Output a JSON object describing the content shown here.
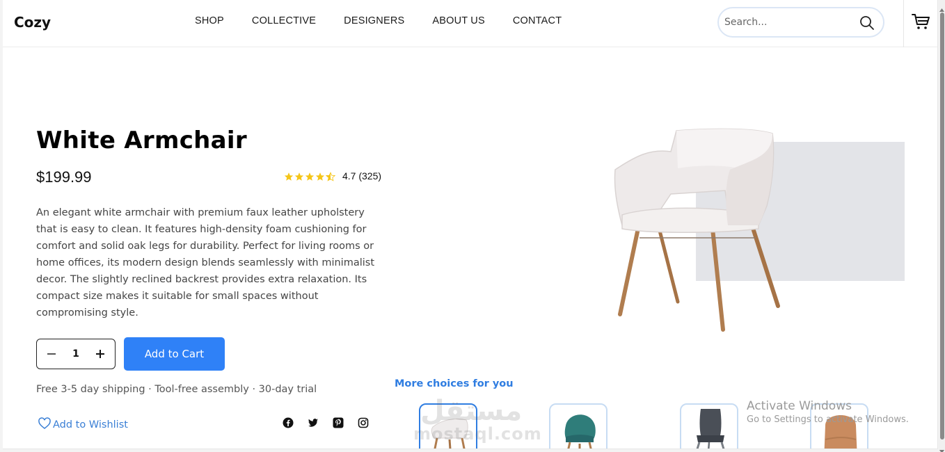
{
  "header": {
    "logo": "Cozy",
    "nav": [
      "SHOP",
      "COLLECTIVE",
      "DESIGNERS",
      "ABOUT US",
      "CONTACT"
    ],
    "search_placeholder": "Search..."
  },
  "product": {
    "title": "White Armchair",
    "price": "$199.99",
    "rating_stars": 4.5,
    "rating_text": "4.7 (325)",
    "description": "An elegant white armchair with premium faux leather upholstery that is easy to clean. It features high-density foam cushioning for comfort and solid oak legs for durability. Perfect for living rooms or home offices, its modern design blends seamlessly with minimalist decor. The slightly reclined backrest provides extra relaxation. Its compact size makes it suitable for small spaces without compromising style.",
    "quantity": "1",
    "add_to_cart": "Add to Cart",
    "perks": "Free 3-5 day shipping · Tool-free assembly · 30-day trial",
    "wishlist": "Add to Wishlist"
  },
  "social": [
    "facebook-icon",
    "twitter-icon",
    "pinterest-icon",
    "instagram-icon"
  ],
  "more_choices": {
    "heading": "More choices for you",
    "thumbnails": [
      "white-chair",
      "teal-chair",
      "grey-chair",
      "tan-chair"
    ]
  },
  "watermark": {
    "arabic": "مستقل",
    "latin": "mostaql.com"
  },
  "os_overlay": {
    "line1": "Activate Windows",
    "line2": "Go to Settings to activate Windows."
  },
  "colors": {
    "accent": "#2f81f7",
    "link": "#3a7fd5",
    "star": "#f5c518"
  }
}
